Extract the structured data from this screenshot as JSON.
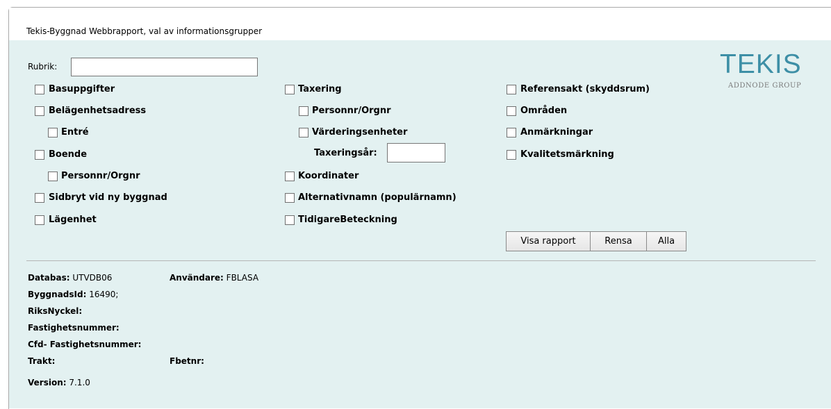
{
  "header": {
    "title": "Tekis-Byggnad Webbrapport, val av informationsgrupper"
  },
  "logo": {
    "name": "TEKIS",
    "tagline": "ADDNODE GROUP",
    "color": "#3d8fa6"
  },
  "form": {
    "rubrik_label": "Rubrik:",
    "rubrik_value": "",
    "taxeringsar_label": "Taxeringsår:",
    "taxeringsar_value": ""
  },
  "options": {
    "basuppgifter": "Basuppgifter",
    "belagenhetsadress": "Belägenhetsadress",
    "entre": "Entré",
    "boende": "Boende",
    "boende_personnr": "Personnr/Orgnr",
    "sidbryt": "Sidbryt vid ny byggnad",
    "lagenhet": "Lägenhet",
    "taxering": "Taxering",
    "taxering_personnr": "Personnr/Orgnr",
    "varderingsenheter": "Värderingsenheter",
    "koordinater": "Koordinater",
    "alternativnamn": "Alternativnamn (populärnamn)",
    "tidigarebeteckning": "TidigareBeteckning",
    "referensakt": "Referensakt (skyddsrum)",
    "omraden": "Områden",
    "anmarkningar": "Anmärkningar",
    "kvalitetsmarkning": "Kvalitetsmärkning"
  },
  "buttons": {
    "visa": "Visa rapport",
    "rensa": "Rensa",
    "alla": "Alla"
  },
  "info": {
    "databas_label": "Databas:",
    "databas_value": "UTVDB06",
    "anvandare_label": "Användare:",
    "anvandare_value": "FBLASA",
    "byggnadsid_label": "ByggnadsId:",
    "byggnadsid_value": "16490;",
    "riksnyckel_label": "RiksNyckel:",
    "fastighetsnummer_label": "Fastighetsnummer:",
    "cfd_label": "Cfd- Fastighetsnummer:",
    "trakt_label": "Trakt:",
    "fbetnr_label": "Fbetnr:",
    "version_label": "Version:",
    "version_value": "7.1.0"
  }
}
